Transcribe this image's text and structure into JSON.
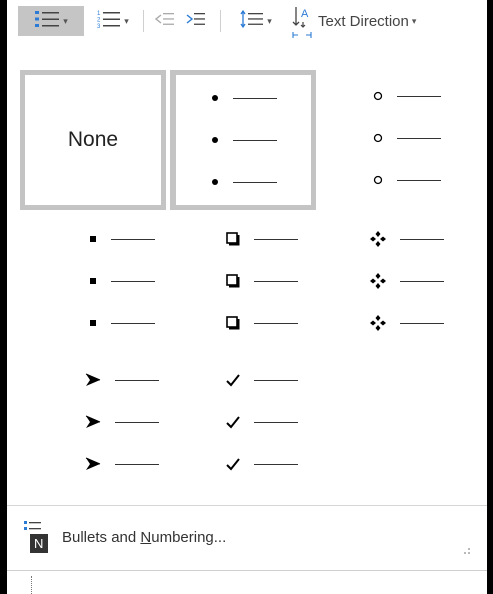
{
  "ribbon": {
    "bullets_icon": "bullets-icon",
    "numbering_icon": "numbering-icon",
    "decrease_indent_icon": "decrease-indent-icon",
    "increase_indent_icon": "increase-indent-icon",
    "line_spacing_icon": "line-spacing-icon",
    "text_direction_icon": "text-direction-icon",
    "text_direction_label": "Text Direction",
    "caret": "▾"
  },
  "bullet_library": {
    "none_label": "None",
    "bullets": [
      {
        "name": "none",
        "symbol": "",
        "selected": false
      },
      {
        "name": "filled-circle",
        "symbol": "●",
        "selected": true
      },
      {
        "name": "hollow-circle",
        "symbol": "○",
        "selected": false
      },
      {
        "name": "filled-square",
        "symbol": "■",
        "selected": false
      },
      {
        "name": "hollow-square",
        "symbol": "❑",
        "selected": false
      },
      {
        "name": "four-diamond",
        "symbol": "❖",
        "selected": false
      },
      {
        "name": "arrowhead",
        "symbol": "➢",
        "selected": false
      },
      {
        "name": "checkmark",
        "symbol": "✔",
        "selected": false
      }
    ]
  },
  "footer": {
    "label_before": "Bullets and ",
    "label_underlined": "N",
    "label_after": "umbering...",
    "icon": "bullets-numbering-icon",
    "icon_letter": "N"
  },
  "colors": {
    "accent_blue": "#2b7bd6",
    "selected_bg": "#c5c5c5",
    "selected_border": "#c4c4c4"
  }
}
